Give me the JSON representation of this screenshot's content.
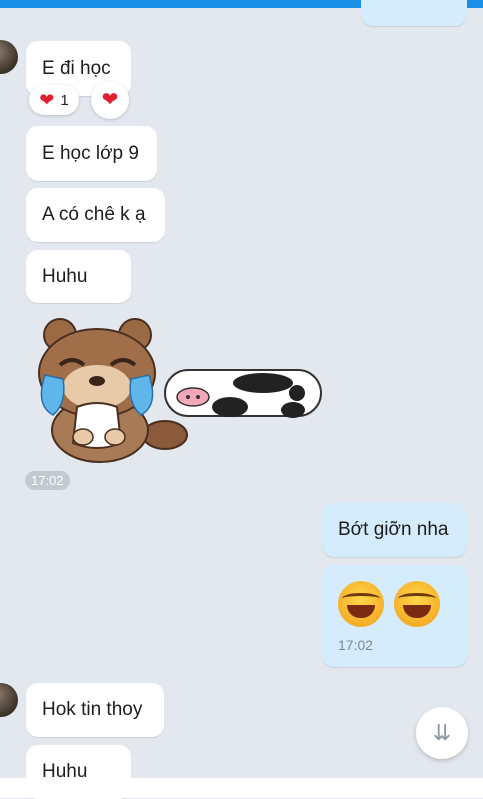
{
  "messages": {
    "m1": "E đi học",
    "m2": "E học lớp 9",
    "m3": "A có chê k ạ",
    "m4": "Huhu",
    "m5": "Bớt giỡn nha",
    "m6": "Hok tin thoy",
    "m7": "Huhu"
  },
  "reaction": {
    "count": "1"
  },
  "times": {
    "sticker": "17:02",
    "emoji": "17:02"
  },
  "icons": {
    "heart": "heart-icon",
    "scroll": "double-chevron-down-icon",
    "emoji": "laughing-tears-emoji"
  },
  "colors": {
    "background": "#e3e8ef",
    "incoming": "#ffffff",
    "outgoing": "#d5ecfd",
    "accent": "#1b8ee8",
    "heart": "#e02030"
  }
}
